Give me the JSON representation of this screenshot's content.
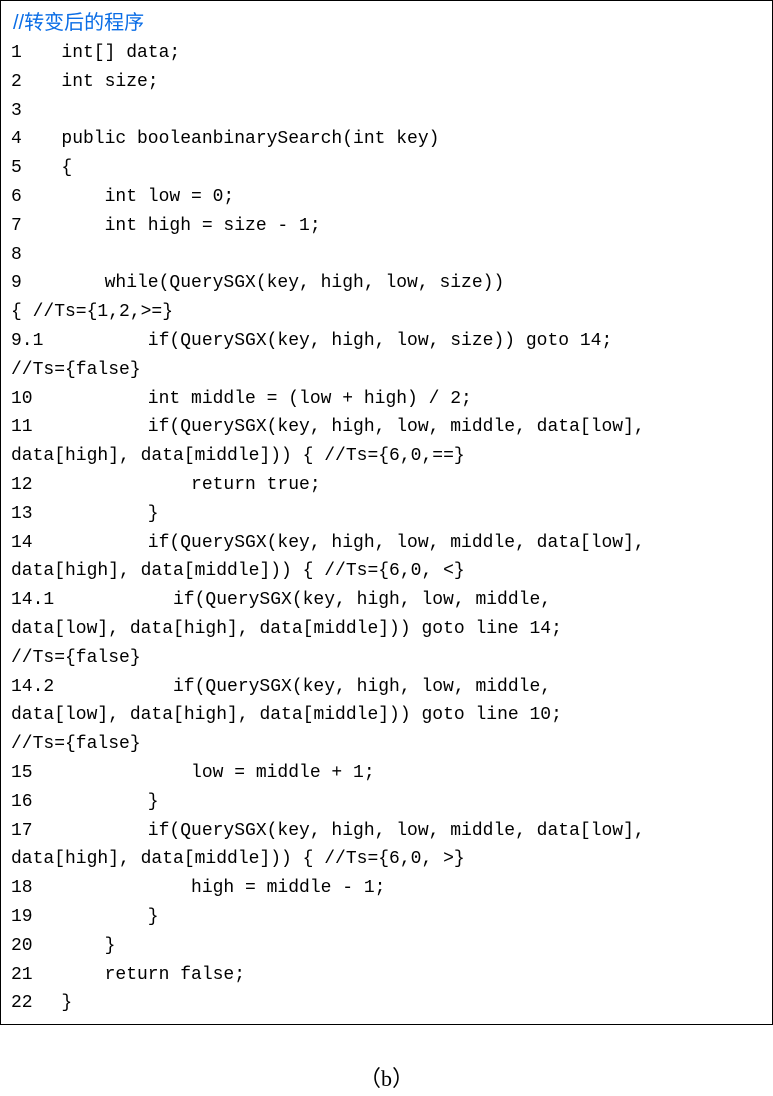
{
  "title_comment": "//转变后的程序",
  "lines": {
    "l1": {
      "no": "1",
      "code": "int[] data;"
    },
    "l2": {
      "no": "2",
      "code": "int size;"
    },
    "l3": {
      "no": "3",
      "code": ""
    },
    "l4": {
      "no": "4",
      "code": "public booleanbinarySearch(int key)"
    },
    "l5": {
      "no": "5",
      "code": "{"
    },
    "l6": {
      "no": "6",
      "code": "    int low = 0;"
    },
    "l7": {
      "no": "7",
      "code": "    int high = size - 1;"
    },
    "l8": {
      "no": "8",
      "code": ""
    },
    "l9": {
      "no": "9",
      "code": "    while(QuerySGX(key, high, low, size))"
    },
    "l9b": "{ //Ts={1,2,>=}",
    "l9_1": {
      "no": "9.1",
      "code": "        if(QuerySGX(key, high, low, size)) goto 14;"
    },
    "l9_1b": "//Ts={false}",
    "l10": {
      "no": "10",
      "code": "        int middle = (low + high) / 2;"
    },
    "l11": {
      "no": "11",
      "code": "        if(QuerySGX(key, high, low, middle, data[low],"
    },
    "l11b": "data[high], data[middle])) { //Ts={6,0,==}",
    "l12": {
      "no": "12",
      "code": "            return true;"
    },
    "l13": {
      "no": "13",
      "code": "        }"
    },
    "l14": {
      "no": "14",
      "code": "        if(QuerySGX(key, high, low, middle, data[low],"
    },
    "l14b": "data[high], data[middle])) { //Ts={6,0, <}",
    "l14_1": {
      "no": "14.1",
      "code": "        if(QuerySGX(key, high, low, middle,"
    },
    "l14_1b": "data[low], data[high], data[middle])) goto line 14;",
    "l14_1c": "//Ts={false}",
    "l14_2": {
      "no": "14.2",
      "code": "        if(QuerySGX(key, high, low, middle,"
    },
    "l14_2b": "data[low], data[high], data[middle])) goto line 10;",
    "l14_2c": "//Ts={false}",
    "l15": {
      "no": "15",
      "code": "            low = middle + 1;"
    },
    "l16": {
      "no": "16",
      "code": "        }"
    },
    "l17": {
      "no": "17",
      "code": "        if(QuerySGX(key, high, low, middle, data[low],"
    },
    "l17b": "data[high], data[middle])) { //Ts={6,0, >}",
    "l18": {
      "no": "18",
      "code": "            high = middle - 1;"
    },
    "l19": {
      "no": "19",
      "code": "        }"
    },
    "l20": {
      "no": "20",
      "code": "    }"
    },
    "l21": {
      "no": "21",
      "code": "    return false;"
    },
    "l22": {
      "no": "22",
      "code": "}"
    }
  },
  "caption": "（b）"
}
